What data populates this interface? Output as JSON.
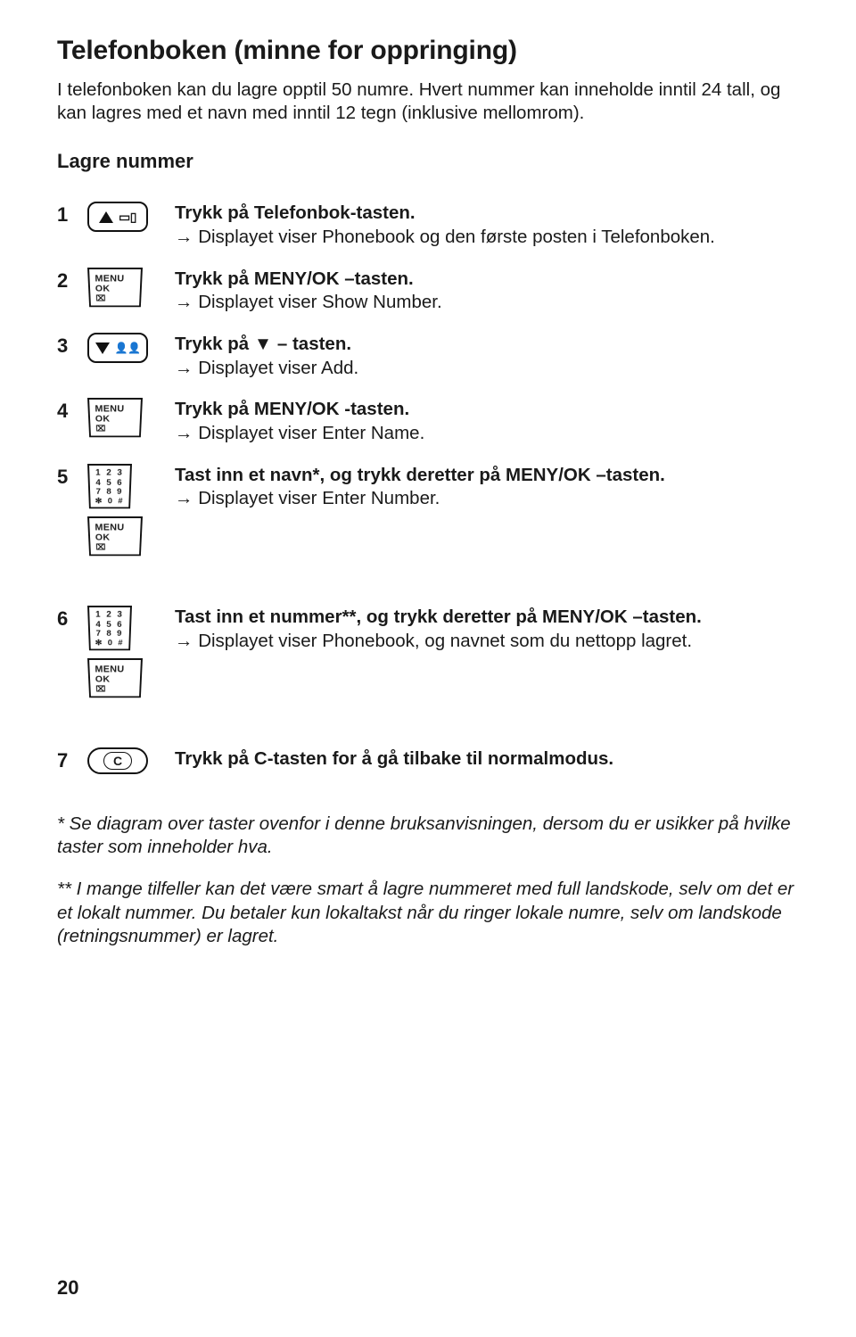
{
  "title": "Telefonboken (minne for oppringing)",
  "intro": "I telefonboken kan du lagre opptil 50 numre. Hvert nummer kan inneholde inntil 24 tall, og kan lagres med et navn med inntil 12 tegn (inklusive mellomrom).",
  "subhead": "Lagre nummer",
  "menuok_label1": "MENU",
  "menuok_label2": "OK",
  "keypad_rows": [
    "1 2 3",
    "4 5 6",
    "7 8 9",
    "✻ 0 #"
  ],
  "c_label": "C",
  "steps": [
    {
      "num": "1",
      "icons": [
        "phonebook-up"
      ],
      "lines": [
        {
          "bold": true,
          "text": "Trykk på Telefonbok-tasten."
        },
        {
          "bold": false,
          "arrow": true,
          "text": "Displayet viser Phonebook og den første posten i Telefonboken."
        }
      ]
    },
    {
      "num": "2",
      "icons": [
        "menuok"
      ],
      "lines": [
        {
          "bold": true,
          "text": "Trykk på MENY/OK –tasten."
        },
        {
          "bold": false,
          "arrow": true,
          "text": "Displayet viser Show Number."
        }
      ]
    },
    {
      "num": "3",
      "icons": [
        "down-key"
      ],
      "lines": [
        {
          "bold": true,
          "text": "Trykk på ▼ – tasten."
        },
        {
          "bold": false,
          "arrow": true,
          "text": "Displayet viser Add."
        }
      ]
    },
    {
      "num": "4",
      "icons": [
        "menuok"
      ],
      "lines": [
        {
          "bold": true,
          "text": "Trykk på MENY/OK -tasten."
        },
        {
          "bold": false,
          "arrow": true,
          "text": "Displayet viser Enter Name."
        }
      ]
    },
    {
      "num": "5",
      "icons": [
        "keypad",
        "menuok"
      ],
      "lines": [
        {
          "bold": true,
          "text": "Tast inn et navn*, og trykk deretter på MENY/OK –tasten."
        },
        {
          "bold": false,
          "arrow": true,
          "text": "Displayet viser Enter Number."
        }
      ]
    },
    {
      "num": "6",
      "icons": [
        "keypad",
        "menuok"
      ],
      "lines": [
        {
          "bold": true,
          "text": "Tast inn et nummer**, og trykk deretter på MENY/OK –tasten."
        },
        {
          "bold": false,
          "arrow": true,
          "text": "Displayet viser Phonebook, og navnet som du nettopp lagret."
        }
      ]
    },
    {
      "num": "7",
      "icons": [
        "c-key"
      ],
      "lines": [
        {
          "bold": true,
          "text": "Trykk på C-tasten for å gå tilbake til normalmodus."
        }
      ]
    }
  ],
  "footnote1": "* Se diagram over taster ovenfor i denne bruksanvisningen, dersom du er usikker på hvilke taster som inneholder hva.",
  "footnote2": "** I mange tilfeller kan det være smart å lagre nummeret med full landskode, selv om det er et lokalt nummer. Du betaler kun lokaltakst når du ringer lokale numre, selv om landskode (retningsnummer) er lagret.",
  "page_number": "20"
}
